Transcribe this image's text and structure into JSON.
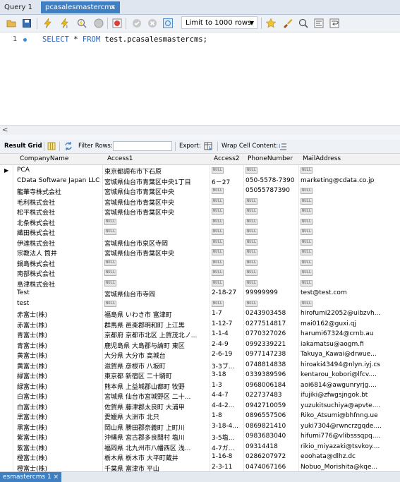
{
  "tabs": [
    {
      "label": "Query 1"
    },
    {
      "label": "pcasalesmastercms",
      "close": "×"
    }
  ],
  "toolbar": {
    "limit_label": "Limit to 1000 rows",
    "icons": [
      "folder-icon",
      "save-icon",
      "lightning-icon",
      "lightning-cursor-icon",
      "magnify-lightning-icon",
      "stop-icon",
      "stop-exec-icon",
      "check-icon",
      "cancel-icon",
      "toggle-icon",
      "star-icon",
      "brush-icon",
      "search-icon",
      "format-icon",
      "wrap-icon"
    ]
  },
  "editor": {
    "line_number": "1",
    "code_kw1": "SELECT",
    "code_mid": " * ",
    "code_kw2": "FROM",
    "code_rest": " test.pcasalesmastercms;"
  },
  "hscroll": {
    "chevron": "<"
  },
  "resultbar": {
    "result_grid": "Result Grid",
    "filter_rows": "Filter Rows:",
    "export": "Export:",
    "wrap": "Wrap Cell Content:"
  },
  "grid": {
    "columns": [
      "CompanyName",
      "Access1",
      "Access2",
      "PhoneNumber",
      "MailAddress"
    ],
    "null_text": "NULL",
    "rows": [
      [
        "PCA",
        "東京都調布市下石原",
        null,
        null,
        null
      ],
      [
        "CData Software Japan LLC",
        "宮城県仙台市青葉区中央1丁目",
        "6－27",
        "050-5578-7390",
        "marketing@cdata.co.jp"
      ],
      [
        "龍華寺株式会社",
        "宮城県仙台市青葉区中央",
        null,
        "05055787390",
        null
      ],
      [
        "毛利株式会社",
        "宮城県仙台市青葉区中央",
        null,
        null,
        null
      ],
      [
        "松平株式会社",
        "宮城県仙台市青葉区中央",
        null,
        null,
        null
      ],
      [
        "北条株式会社",
        null,
        null,
        null,
        null
      ],
      [
        "織田株式会社",
        null,
        null,
        null,
        null
      ],
      [
        "伊達株式会社",
        "宮城県仙台市泉区寺岡",
        null,
        null,
        null
      ],
      [
        "宗教法人 筒井",
        "宮城県仙台市青葉区中央",
        null,
        null,
        null
      ],
      [
        "鍋島株式会社",
        null,
        null,
        null,
        null
      ],
      [
        "南部株式会社",
        null,
        null,
        null,
        null
      ],
      [
        "島津株式会社",
        null,
        null,
        null,
        null
      ],
      [
        "Test",
        "宮城県仙台市寺岡",
        "2-18-27",
        "99999999",
        "test@test.com"
      ],
      [
        "test",
        null,
        null,
        null,
        null
      ],
      [
        "赤富士(株)",
        "福島県 いわき市 富津町",
        "1-7",
        "0243903458",
        "hirofumi22052@uibzvh..."
      ],
      [
        "赤富士(株)",
        "群馬県 邑楽郡明和町 上江黒",
        "1-12-7",
        "0277514817",
        "mai0162@guxi.qj"
      ],
      [
        "青富士(株)",
        "京都府 京都市北区 上賀茂北ノ...",
        "1-1-4",
        "0770327026",
        "harumi67324@crnb.au"
      ],
      [
        "青富士(株)",
        "鹿児島県 大島郡与論町 東区",
        "2-4-9",
        "0992339221",
        "iakamatsu@aogm.fi"
      ],
      [
        "黄富士(株)",
        "大分県 大分市 高城台",
        "2-6-19",
        "0977147238",
        "Takuya_Kawai@drwue..."
      ],
      [
        "黄富士(株)",
        "滋賀県 彦根市 八坂町",
        "3-3ブ...",
        "0748814838",
        "hiroaki43494@nlyn.iyj.cs"
      ],
      [
        "緑富士(株)",
        "東京都 新宿区 二十騎町",
        "3-18",
        "0339389596",
        "kentarou_kobori@lfcv...."
      ],
      [
        "緑富士(株)",
        "熊本県 上益城郡山都町 牧野",
        "1-3",
        "0968006184",
        "aoi6814@awgunryrjg...."
      ],
      [
        "白富士(株)",
        "宮城県 仙台市宮城野区 二十...",
        "4-4-7",
        "022737483",
        "ifujiki@zfwgsjngok.bt"
      ],
      [
        "白富士(株)",
        "佐賀県 藤津郡太良町 大浦甲",
        "4-4-2...",
        "0942710059",
        "yuzukitsuchiya@apvte...."
      ],
      [
        "黒富士(株)",
        "愛媛県 大洲市 北只",
        "1-8",
        "0896557506",
        "Riko_Atsumi@bhfnng.ue"
      ],
      [
        "黒富士(株)",
        "岡山県 勝田郡奈義町 上町川",
        "3-18-4...",
        "0869821410",
        "yuki7304@rwncrzgqde...."
      ],
      [
        "紫富士(株)",
        "沖縄県 宮古郡多良間村 塩川",
        "3-5塩...",
        "0983683040",
        "hifumi776@vlibsssqpq...."
      ],
      [
        "紫富士(株)",
        "福岡県 北九州市八幡西区 浅...",
        "4-7ガ...",
        "09314418",
        "rikio_miyazaki@tsvkoy...."
      ],
      [
        "橙富士(株)",
        "栃木県 栃木市 大平町蔵井",
        "1-16-8",
        "0286207972",
        "eoohata@dlhz.dc"
      ],
      [
        "橙富士(株)",
        "千葉県 富津市 平山",
        "2-3-11",
        "0474067166",
        "Nobuo_Morishita@kqe..."
      ]
    ]
  },
  "bottom_tab": {
    "label": "esmastercms 1 ×"
  }
}
